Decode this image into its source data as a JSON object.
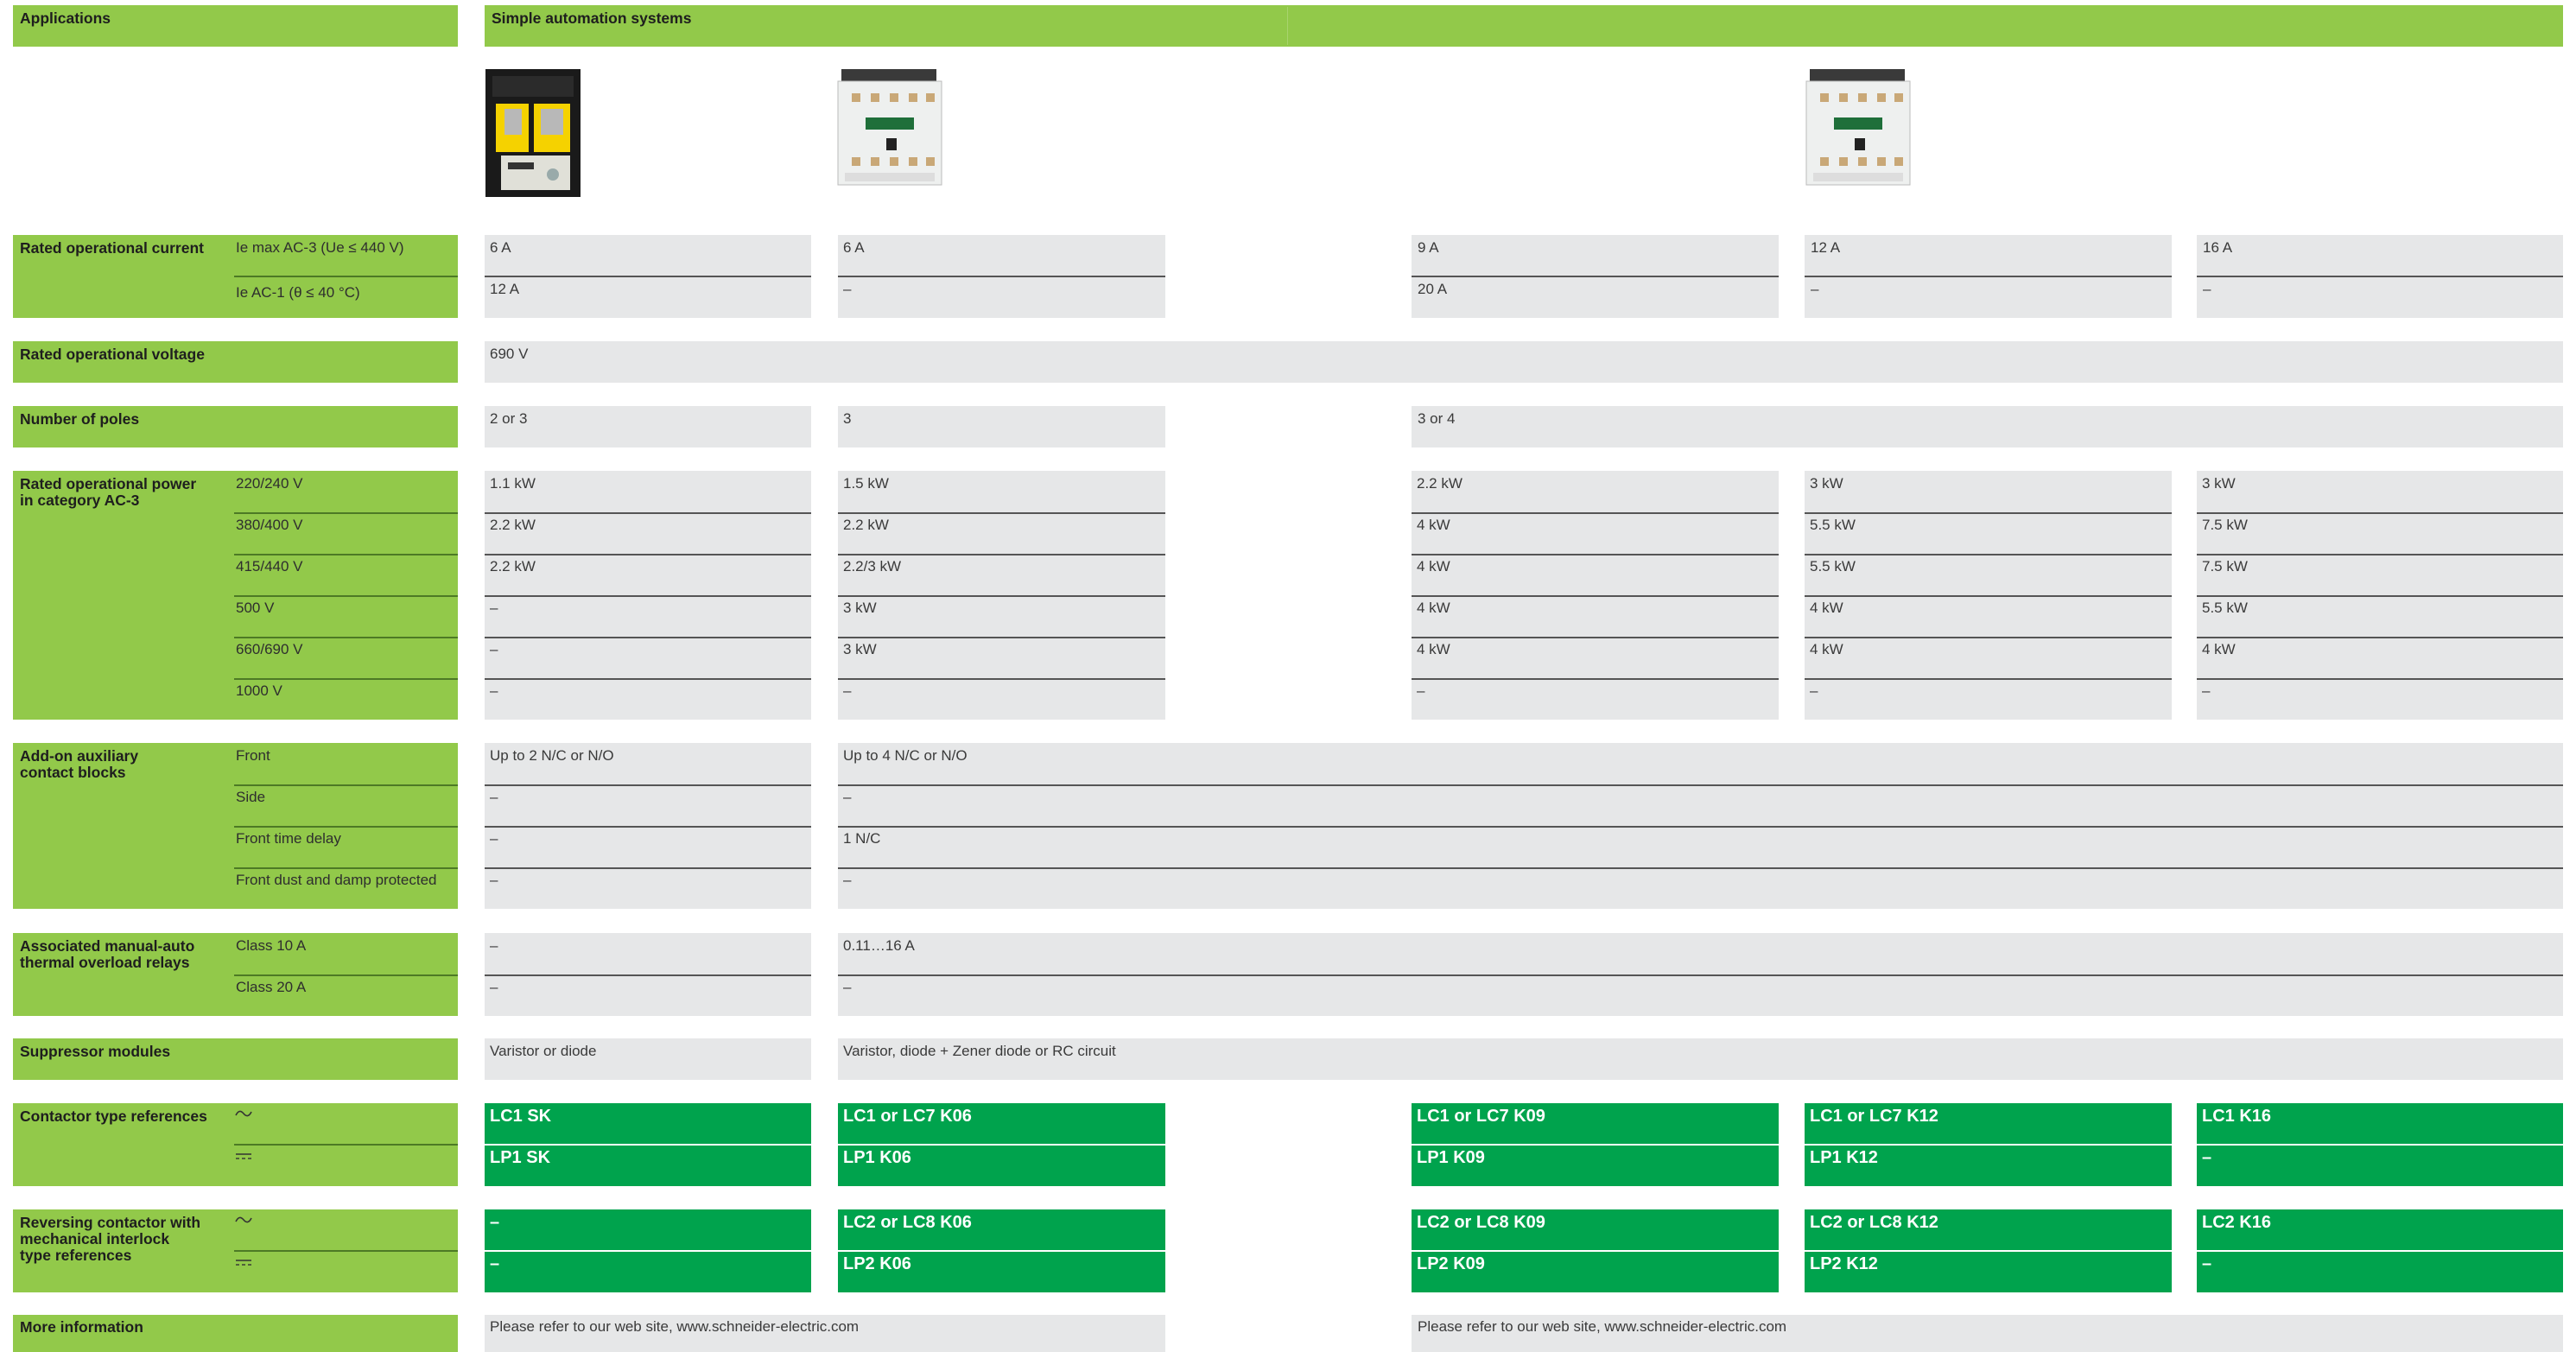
{
  "header": {
    "applications": "Applications",
    "systems": "Simple automation systems"
  },
  "rows": {
    "current": {
      "label": "Rated operational current",
      "sub1": "Ie max AC-3 (Ue ≤ 440 V)",
      "sub2": "Ie AC-1 (θ ≤ 40 °C)"
    },
    "voltage": {
      "label": "Rated operational voltage",
      "value": "690 V"
    },
    "poles": {
      "label": "Number of poles",
      "values": [
        "2 or 3",
        "3",
        "3 or 4"
      ]
    },
    "power": {
      "label1": "Rated operational power",
      "label2": "in category AC-3",
      "subs": [
        "220/240 V",
        "380/400 V",
        "415/440 V",
        "500 V",
        "660/690 V",
        "1000 V"
      ]
    },
    "addon": {
      "label1": "Add-on auxiliary",
      "label2": "contact blocks",
      "subs": [
        "Front",
        "Side",
        "Front time delay",
        "Front dust and damp protected"
      ]
    },
    "thermal": {
      "label1": "Associated manual-auto",
      "label2": "thermal overload relays",
      "subs": [
        "Class 10 A",
        "Class 20 A"
      ]
    },
    "suppressor": {
      "label": "Suppressor modules",
      "values": [
        "Varistor or diode",
        "Varistor, diode + Zener diode or RC circuit"
      ]
    },
    "contactor": {
      "label": "Contactor type references"
    },
    "reversing": {
      "label1": "Reversing contactor with",
      "label2": "mechanical interlock",
      "label3": "type references"
    },
    "more": {
      "label": "More information",
      "value": "Please refer to our web site, www.schneider-electric.com"
    }
  },
  "cols": [
    {
      "current": [
        "6 A",
        "12 A"
      ],
      "power": [
        "1.1 kW",
        "2.2 kW",
        "2.2 kW",
        "–",
        "–",
        "–"
      ],
      "addon": [
        "Up to 2 N/C or N/O",
        "–",
        "–",
        "–"
      ],
      "thermal": [
        "–",
        "–"
      ],
      "ref1": "LC1 SK",
      "ref2": "LP1 SK",
      "rev1": "–",
      "rev2": "–"
    },
    {
      "current": [
        "6 A",
        "–"
      ],
      "power": [
        "1.5 kW",
        "2.2 kW",
        "2.2/3 kW",
        "3 kW",
        "3 kW",
        "–"
      ],
      "addon": [
        "Up to 4 N/C or N/O",
        "–",
        "1 N/C",
        "–"
      ],
      "thermal": [
        "0.11…16 A",
        "–"
      ],
      "ref1": "LC1 or LC7 K06",
      "ref2": "LP1 K06",
      "rev1": "LC2 or LC8 K06",
      "rev2": "LP2 K06"
    },
    {
      "current": [
        "9 A",
        "20 A"
      ],
      "power": [
        "2.2 kW",
        "4 kW",
        "4 kW",
        "4 kW",
        "4 kW",
        "–"
      ],
      "ref1": "LC1 or LC7 K09",
      "ref2": "LP1 K09",
      "rev1": "LC2 or LC8 K09",
      "rev2": "LP2 K09"
    },
    {
      "current": [
        "12 A",
        "–"
      ],
      "power": [
        "3 kW",
        "5.5 kW",
        "5.5 kW",
        "4 kW",
        "4 kW",
        "–"
      ],
      "ref1": "LC1 or LC7 K12",
      "ref2": "LP1 K12",
      "rev1": "LC2 or LC8 K12",
      "rev2": "LP2 K12"
    },
    {
      "current": [
        "16 A",
        "–"
      ],
      "power": [
        "3 kW",
        "7.5 kW",
        "7.5 kW",
        "5.5 kW",
        "4 kW",
        "–"
      ],
      "ref1": "LC1 K16",
      "ref2": "–",
      "rev1": "LC2 K16",
      "rev2": "–"
    }
  ],
  "colors": {
    "green_label": "#92c94a",
    "green_ref": "#00a34d",
    "grey_cell": "#e6e7e8"
  },
  "icons": {
    "ac": "ac-current-icon",
    "dc": "dc-current-icon"
  }
}
